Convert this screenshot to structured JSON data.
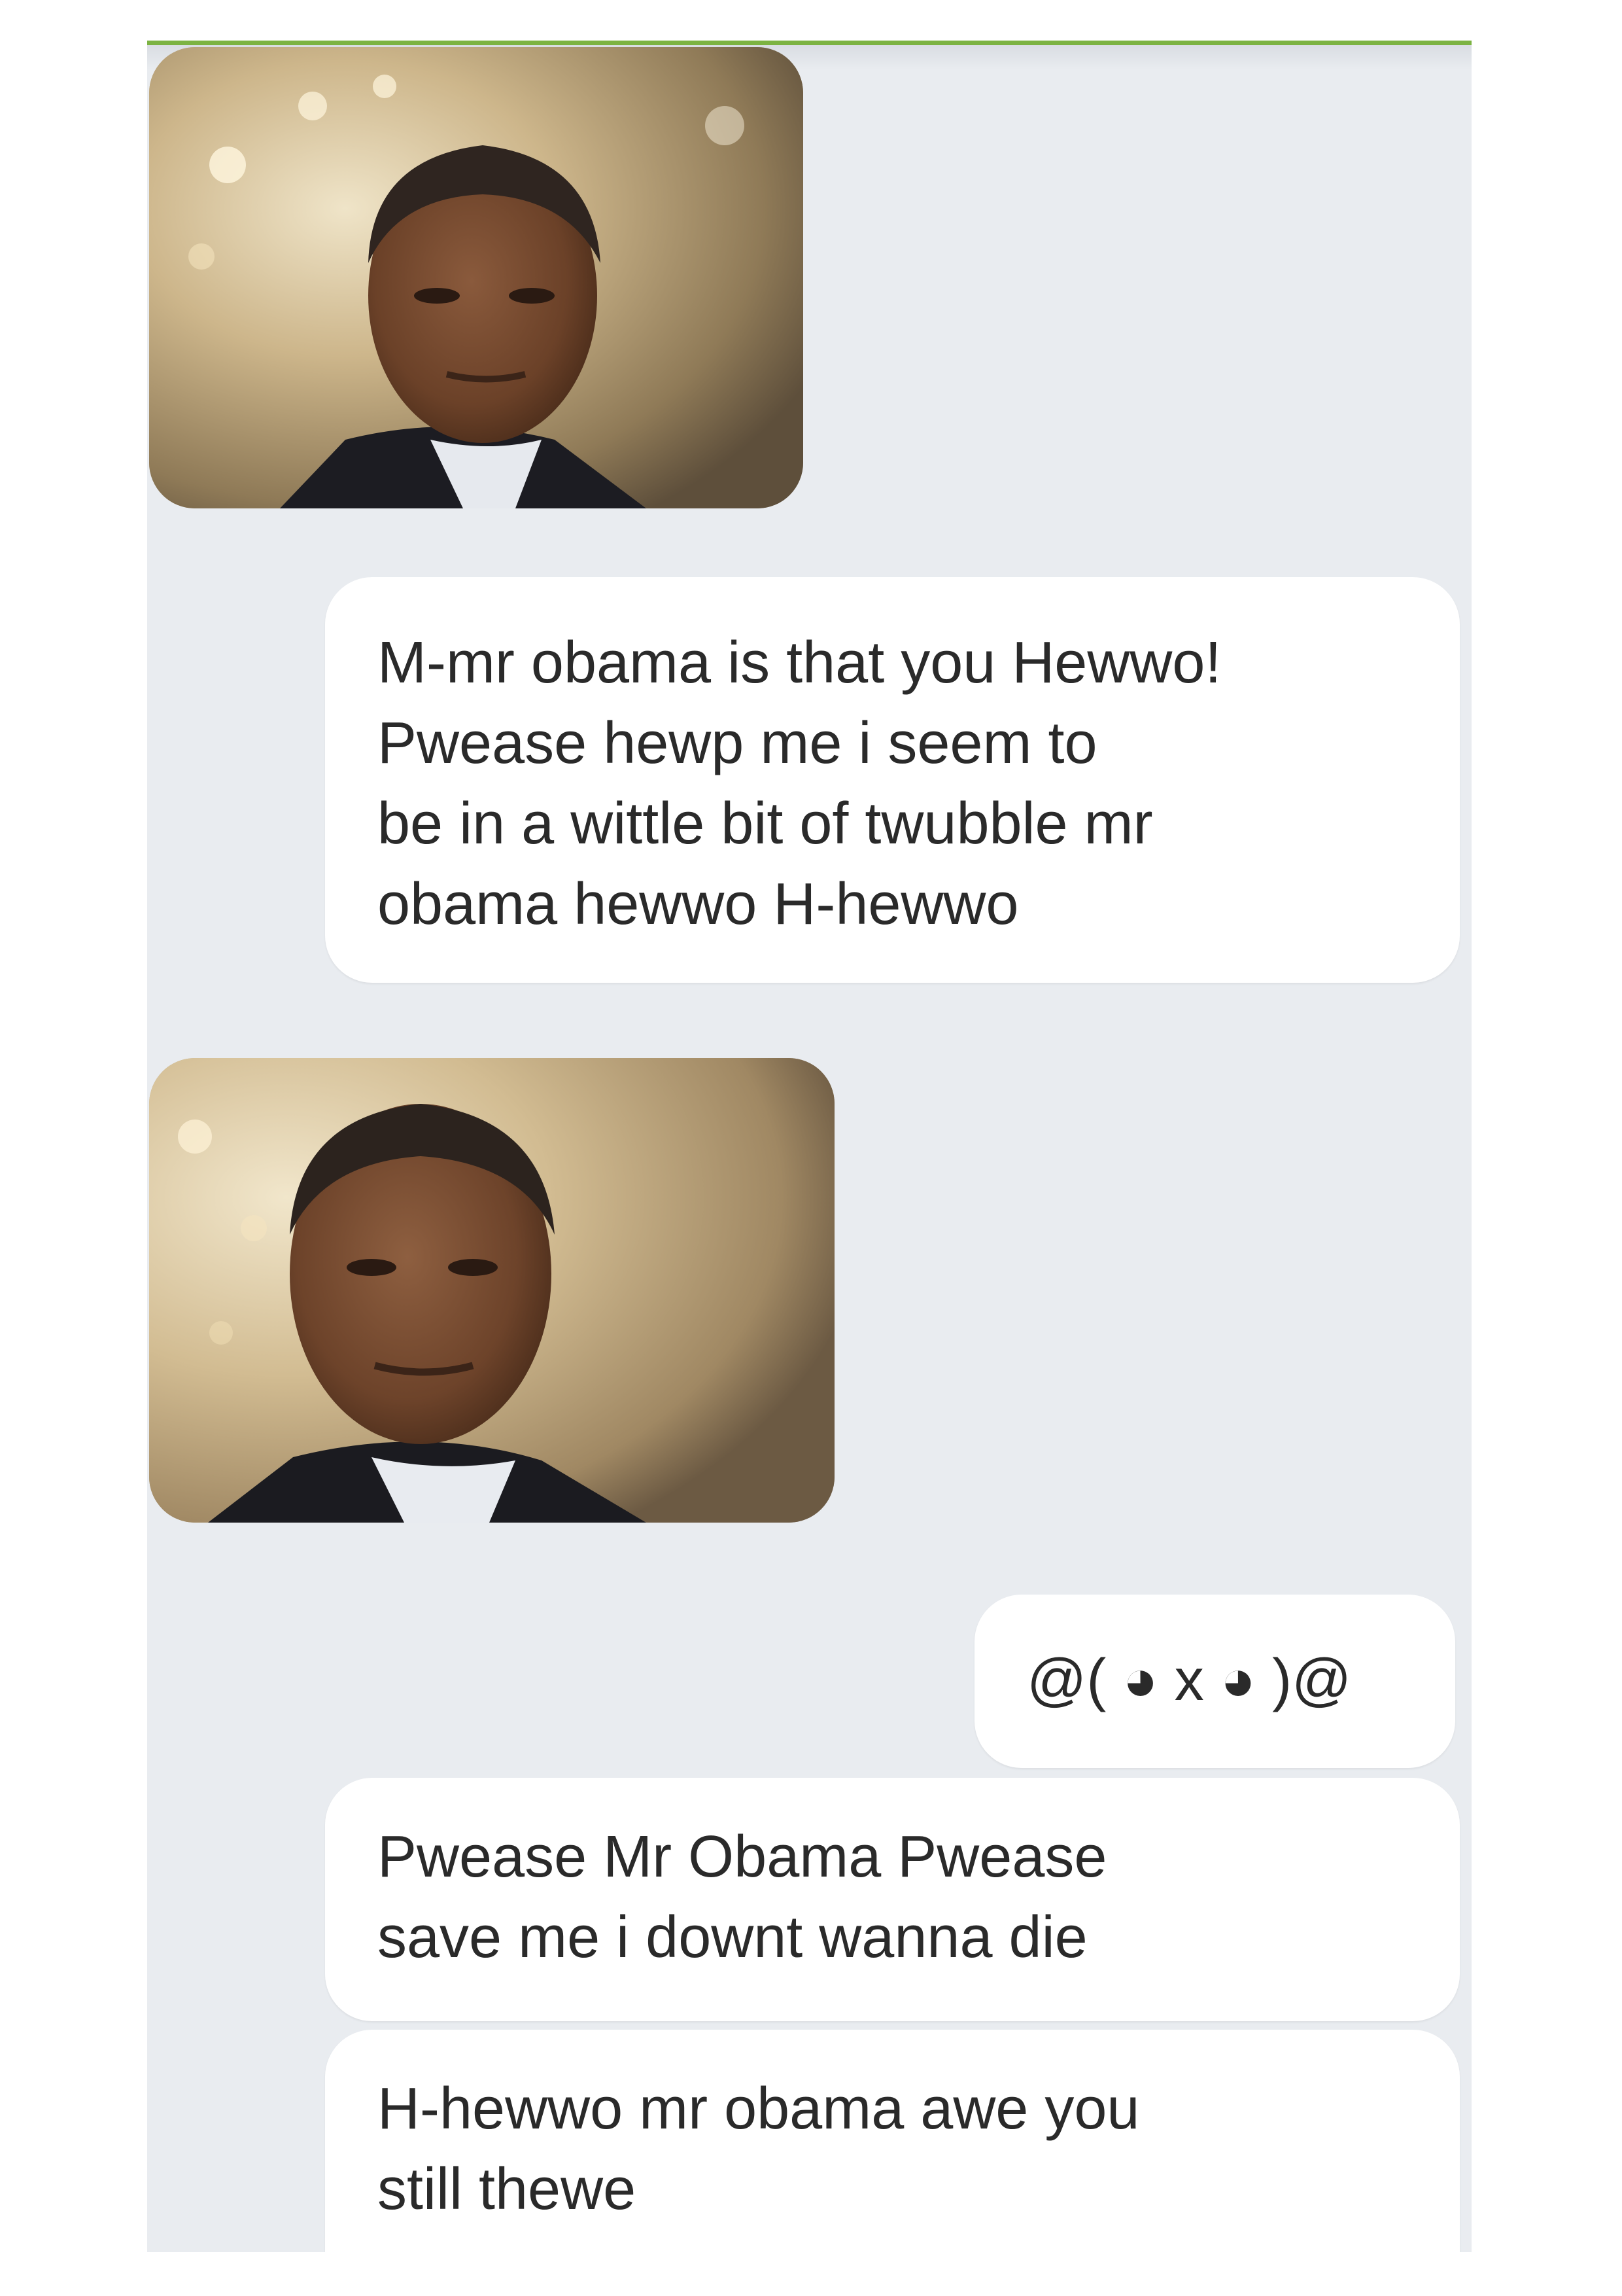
{
  "messages": [
    {
      "type": "image",
      "sender": "other",
      "image": "man-in-suit-photo"
    },
    {
      "type": "text",
      "sender": "self",
      "text": "M-mr obama is that you Hewwo!\nPwease hewp me i seem to\nbe in a wittle bit of twubble mr\nobama hewwo H-hewwo"
    },
    {
      "type": "image",
      "sender": "other",
      "image": "man-in-suit-photo"
    },
    {
      "type": "text",
      "sender": "self",
      "text": "@( ◕ x ◕ )@"
    },
    {
      "type": "text",
      "sender": "self",
      "text": "Pwease Mr Obama Pwease\nsave me i downt wanna die"
    },
    {
      "type": "text",
      "sender": "self",
      "text": "H-hewwo mr obama awe you\nstill thewe"
    }
  ],
  "colors": {
    "chat_background": "#e9ecf0",
    "bubble_background": "#ffffff",
    "text": "#2a2a2a",
    "accent_line": "#7cb342"
  }
}
